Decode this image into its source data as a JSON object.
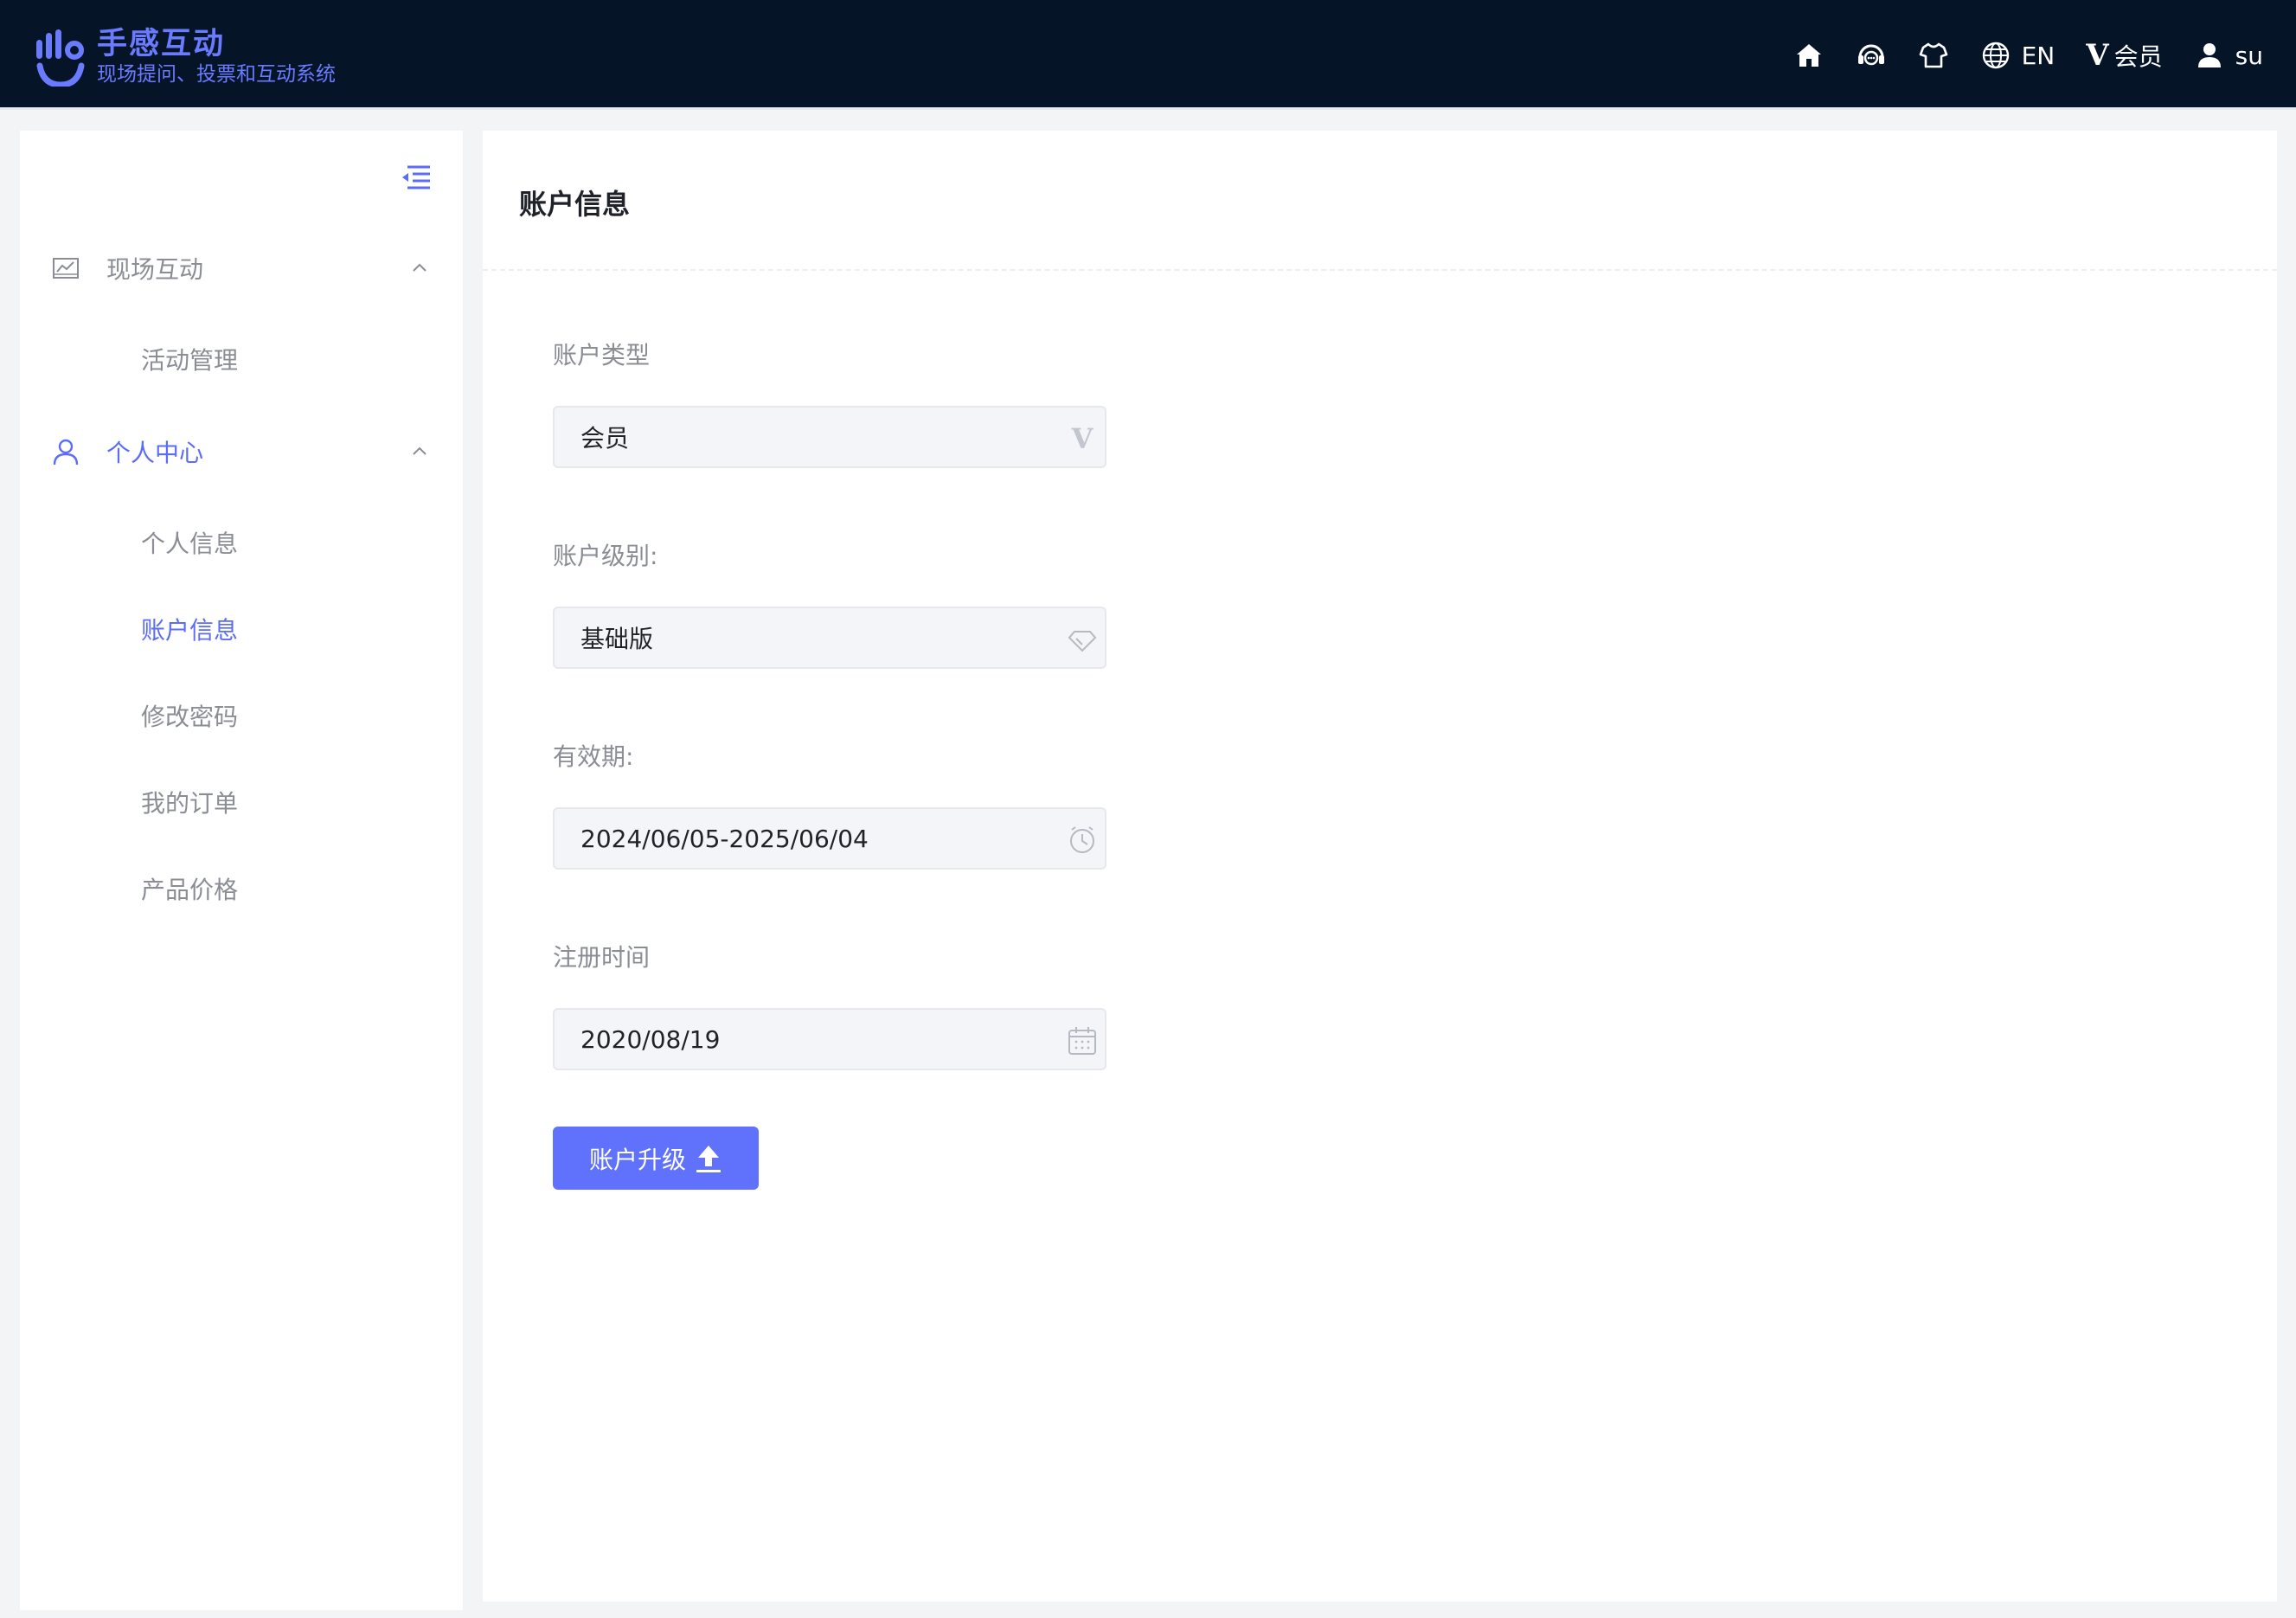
{
  "header": {
    "brand_title": "手感互动",
    "brand_subtitle": "现场提问、投票和互动系统",
    "language": "EN",
    "vip_mark": "V",
    "vip_label": "会员",
    "user": "su"
  },
  "sidebar": {
    "groups": [
      {
        "label": "现场互动",
        "icon": "chart-icon",
        "items": [
          "活动管理"
        ]
      },
      {
        "label": "个人中心",
        "icon": "user-icon",
        "items": [
          "个人信息",
          "账户信息",
          "修改密码",
          "我的订单",
          "产品价格"
        ]
      }
    ],
    "active_item": "账户信息"
  },
  "main": {
    "title": "账户信息",
    "fields": [
      {
        "label": "账户类型",
        "value": "会员",
        "icon": "vip-icon"
      },
      {
        "label": "账户级别:",
        "value": "基础版",
        "icon": "diamond-icon"
      },
      {
        "label": "有效期:",
        "value": "2024/06/05-2025/06/04",
        "icon": "clock-icon"
      },
      {
        "label": "注册时间",
        "value": "2020/08/19",
        "icon": "calendar-icon"
      }
    ],
    "upgrade_label": "账户升级"
  },
  "colors": {
    "header_bg": "#061428",
    "accent": "#5b6cf9",
    "button_bg": "#6072fb"
  }
}
